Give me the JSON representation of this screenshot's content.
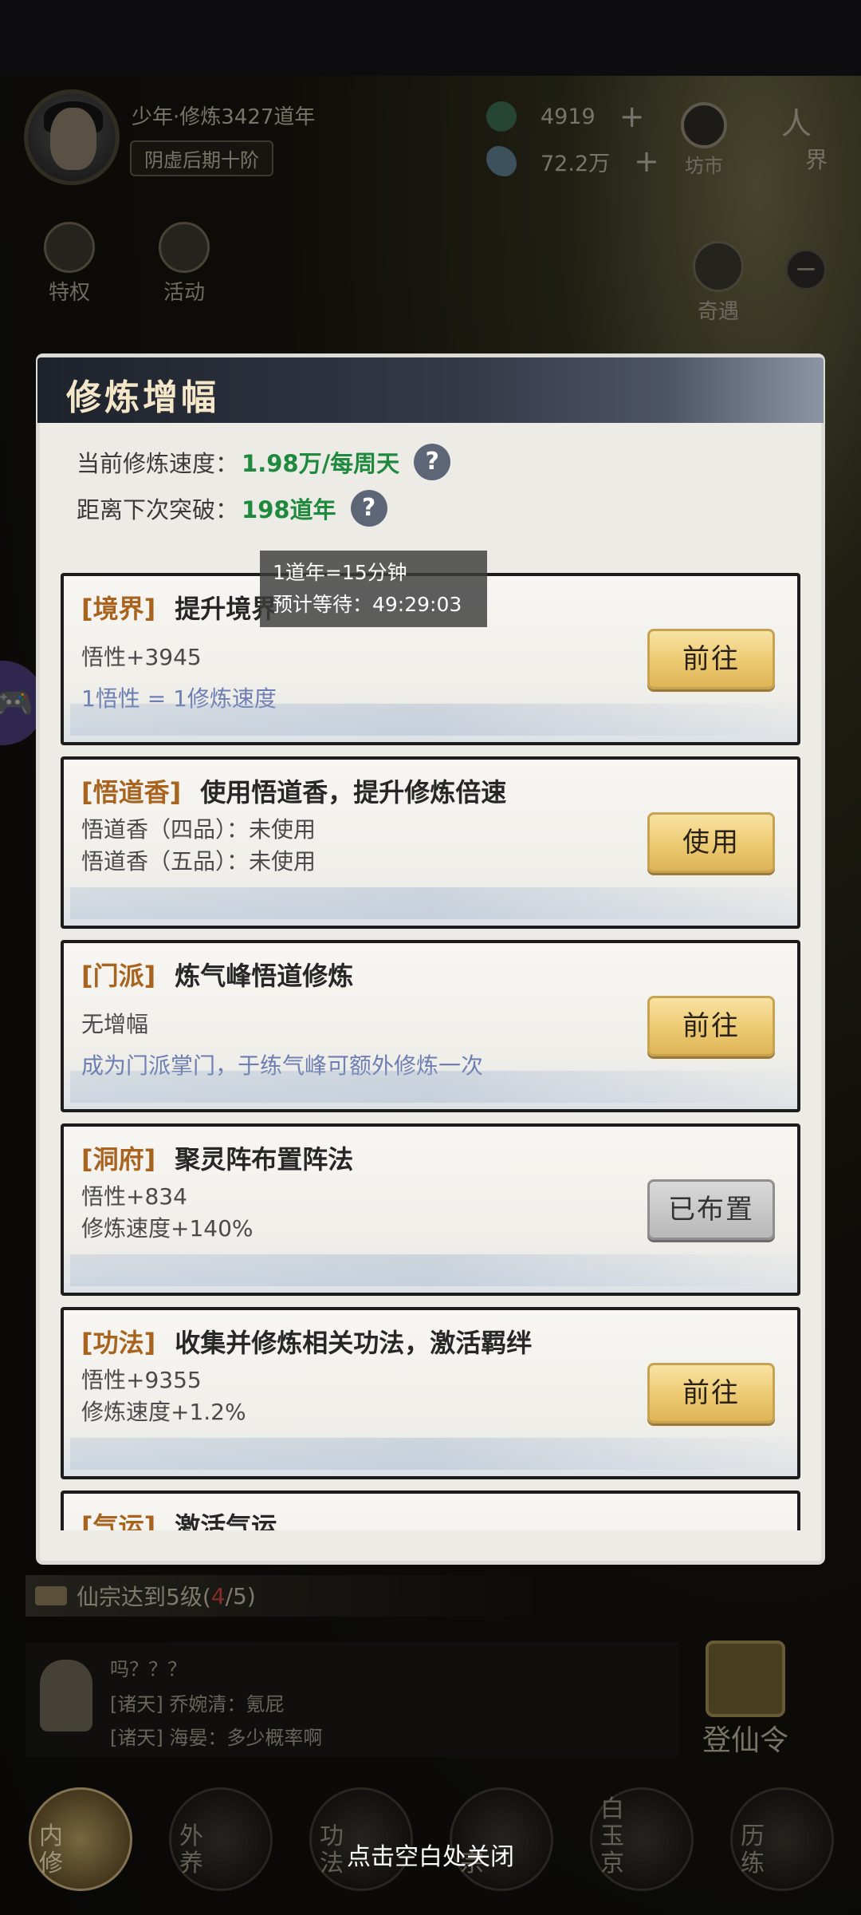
{
  "player": {
    "name_line": "少年·修炼3427道年",
    "realm": "阴虚后期十阶"
  },
  "resources": [
    {
      "icon": "jade-icon",
      "value": "4919"
    },
    {
      "icon": "spirit-stone-icon",
      "value": "72.2万"
    }
  ],
  "top_menu": {
    "market": "坊市",
    "world_label": "人",
    "world_label_2": "界",
    "privilege": "特权",
    "activity": "活动",
    "encounter": "奇遇"
  },
  "modal": {
    "title": "修炼增幅",
    "speed_label": "当前修炼速度：",
    "speed_value": "1.98万/每周天",
    "breakthrough_label": "距离下次突破：",
    "breakthrough_value": "198道年",
    "tooltip_line1": "1道年=15分钟",
    "tooltip_line2": "预计等待：49:29:03",
    "cards": [
      {
        "tag": "[境界]",
        "title": "提升境界",
        "line1": "悟性+3945",
        "line2": "1悟性 = 1修炼速度",
        "button": "前往"
      },
      {
        "tag": "[悟道香]",
        "title": "使用悟道香，提升修炼倍速",
        "line1": "悟道香（四品）：未使用",
        "line2": "悟道香（五品）：未使用",
        "button": "使用"
      },
      {
        "tag": "[门派]",
        "title": "炼气峰悟道修炼",
        "line1": "无增幅",
        "line2": "成为门派掌门，于练气峰可额外修炼一次",
        "button": "前往"
      },
      {
        "tag": "[洞府]",
        "title": "聚灵阵布置阵法",
        "line1": "悟性+834",
        "line2": "修炼速度+140%",
        "button": "已布置"
      },
      {
        "tag": "[功法]",
        "title": "收集并修炼相关功法，激活羁绊",
        "line1": "悟性+9355",
        "line2": "修炼速度+1.2%",
        "button": "前往"
      },
      {
        "tag": "[气运]",
        "title": "激活气运"
      }
    ]
  },
  "quest": {
    "text": "仙宗达到5级(",
    "progress": "4",
    "text_end": "/5)"
  },
  "chat": {
    "line1": "吗？？？",
    "line2": "[诸天] 乔婉清：氪屁",
    "line3": "[诸天] 海晏：多少概率啊"
  },
  "dengxianling": "登仙令",
  "bottom_nav": [
    {
      "label": "内修",
      "active": true
    },
    {
      "label": "外养"
    },
    {
      "label": "功法"
    },
    {
      "label": "宗"
    },
    {
      "label": "白玉京"
    },
    {
      "label": "历练"
    }
  ],
  "close_hint": "点击空白处关闭"
}
